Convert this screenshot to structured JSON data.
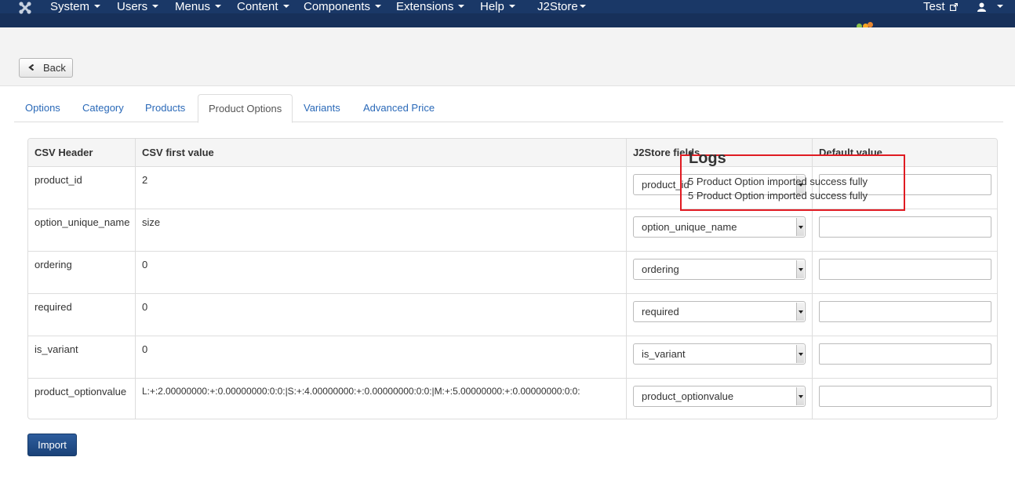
{
  "navbar": {
    "menus": [
      {
        "label": "System"
      },
      {
        "label": "Users"
      },
      {
        "label": "Menus"
      },
      {
        "label": "Content"
      },
      {
        "label": "Components"
      },
      {
        "label": "Extensions"
      },
      {
        "label": "Help"
      },
      {
        "label": "J2Store"
      }
    ],
    "site_link": "Test",
    "colors": {
      "bar": "#1a3867",
      "accent_red": "#e01b22"
    }
  },
  "toolbar": {
    "back_label": "Back"
  },
  "tabs": [
    {
      "label": "Options"
    },
    {
      "label": "Category"
    },
    {
      "label": "Products"
    },
    {
      "label": "Product Options",
      "active": true
    },
    {
      "label": "Variants"
    },
    {
      "label": "Advanced Price"
    }
  ],
  "table": {
    "headers": [
      "CSV Header",
      "CSV first value",
      "J2Store fields",
      "Default value"
    ],
    "rows": [
      {
        "csv_header": "product_id",
        "csv_value": "2",
        "field": "product_id",
        "default": ""
      },
      {
        "csv_header": "option_unique_name",
        "csv_value": "size",
        "field": "option_unique_name",
        "default": ""
      },
      {
        "csv_header": "ordering",
        "csv_value": "0",
        "field": "ordering",
        "default": ""
      },
      {
        "csv_header": "required",
        "csv_value": "0",
        "field": "required",
        "default": ""
      },
      {
        "csv_header": "is_variant",
        "csv_value": "0",
        "field": "is_variant",
        "default": ""
      },
      {
        "csv_header": "product_optionvalue",
        "csv_value": "L:+:2.00000000:+:0.00000000:0:0:|S:+:4.00000000:+:0.00000000:0:0:|M:+:5.00000000:+:0.00000000:0:0:",
        "field": "product_optionvalue",
        "default": ""
      }
    ]
  },
  "logs": {
    "title": "Logs",
    "lines": [
      "5 Product Option imported success fully",
      "5 Product Option imported success fully"
    ]
  },
  "actions": {
    "import_label": "Import"
  }
}
